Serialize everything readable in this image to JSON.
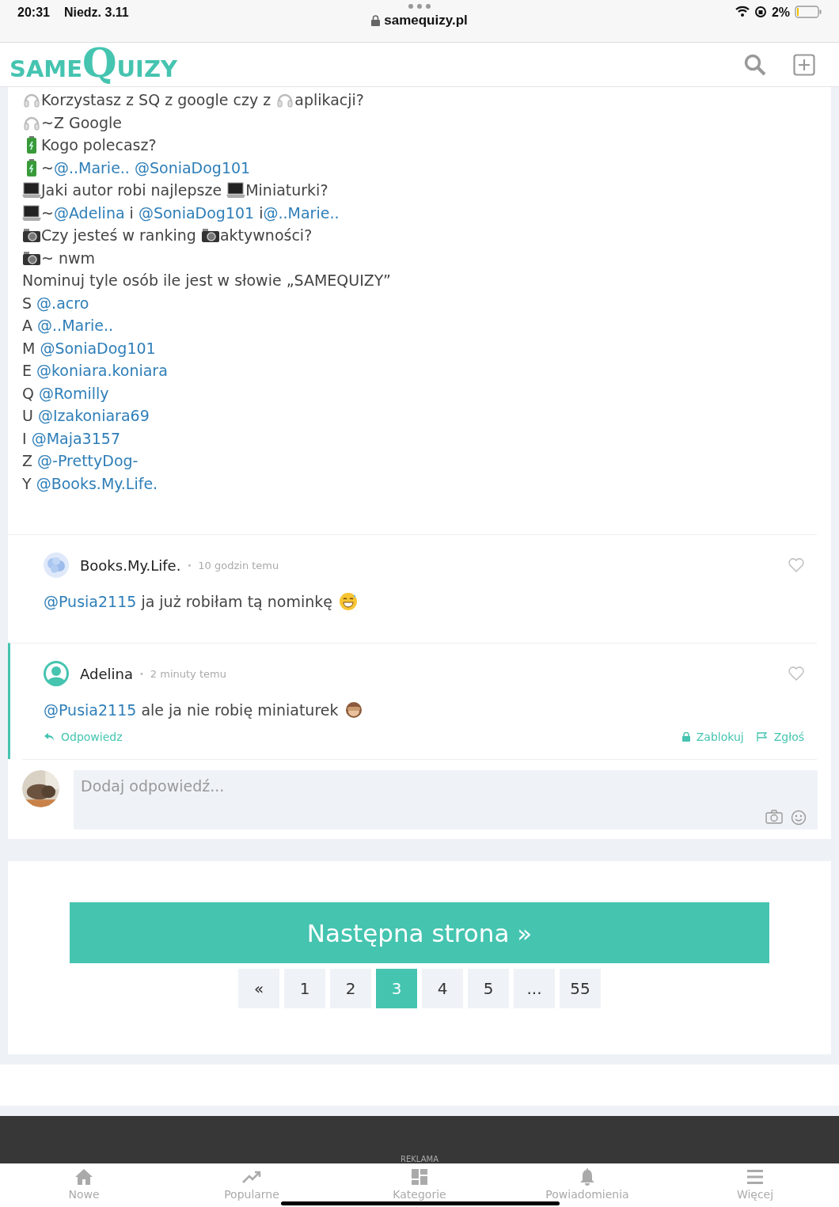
{
  "status_bar": {
    "time": "20:31",
    "date": "Niedz. 3.11",
    "battery": "2%",
    "url": "samequizy.pl"
  },
  "header": {
    "logo_small": "SAME",
    "logo_big": "Q",
    "logo_rest": "UIZY"
  },
  "post": {
    "lines": [
      [
        {
          "kind": "headphones"
        },
        {
          "kind": "text",
          "text": "Korzystasz z SQ z google czy z "
        },
        {
          "kind": "headphones"
        },
        {
          "kind": "text",
          "text": "aplikacji?"
        }
      ],
      [
        {
          "kind": "headphones"
        },
        {
          "kind": "text",
          "text": "~Z Google"
        }
      ],
      [
        {
          "kind": "battery"
        },
        {
          "kind": "text",
          "text": "Kogo polecasz?"
        }
      ],
      [
        {
          "kind": "battery"
        },
        {
          "kind": "text",
          "text": "~"
        },
        {
          "kind": "mention",
          "text": "@..Marie.."
        },
        {
          "kind": "mention",
          "text": " @SoniaDog101"
        }
      ],
      [
        {
          "kind": "laptop"
        },
        {
          "kind": "text",
          "text": "Jaki autor robi najlepsze "
        },
        {
          "kind": "laptop"
        },
        {
          "kind": "text",
          "text": "Miniaturki?"
        }
      ],
      [
        {
          "kind": "laptop"
        },
        {
          "kind": "text",
          "text": "~"
        },
        {
          "kind": "mention",
          "text": "@Adelina"
        },
        {
          "kind": "text",
          "text": " i "
        },
        {
          "kind": "mention",
          "text": "@SoniaDog101"
        },
        {
          "kind": "text",
          "text": " i"
        },
        {
          "kind": "mention",
          "text": "@..Marie.."
        }
      ],
      [
        {
          "kind": "camera"
        },
        {
          "kind": "text",
          "text": "Czy jesteś w ranking "
        },
        {
          "kind": "camera"
        },
        {
          "kind": "text",
          "text": "aktywności?"
        }
      ],
      [
        {
          "kind": "camera"
        },
        {
          "kind": "text",
          "text": "~ nwm"
        }
      ],
      [
        {
          "kind": "text",
          "text": "Nominuj tyle osób ile jest w słowie „SAMEQUIZY”"
        }
      ],
      [
        {
          "kind": "text",
          "text": "S "
        },
        {
          "kind": "mention",
          "text": "@.acro"
        }
      ],
      [
        {
          "kind": "text",
          "text": "A "
        },
        {
          "kind": "mention",
          "text": "@..Marie.."
        }
      ],
      [
        {
          "kind": "text",
          "text": "M "
        },
        {
          "kind": "mention",
          "text": "@SoniaDog101"
        }
      ],
      [
        {
          "kind": "text",
          "text": "E "
        },
        {
          "kind": "mention",
          "text": "@koniara.koniara"
        }
      ],
      [
        {
          "kind": "text",
          "text": "Q "
        },
        {
          "kind": "mention",
          "text": "@Romilly"
        }
      ],
      [
        {
          "kind": "text",
          "text": "U "
        },
        {
          "kind": "mention",
          "text": "@Izakoniara69"
        }
      ],
      [
        {
          "kind": "text",
          "text": "I "
        },
        {
          "kind": "mention",
          "text": "@Maja3157"
        }
      ],
      [
        {
          "kind": "text",
          "text": "Z "
        },
        {
          "kind": "mention",
          "text": "@-PrettyDog-"
        }
      ],
      [
        {
          "kind": "text",
          "text": "Y "
        },
        {
          "kind": "mention",
          "text": "@Books.My.Life."
        }
      ]
    ]
  },
  "comments": [
    {
      "author": "Books.My.Life.",
      "separator": "•",
      "time": "10 godzin temu",
      "mention": "@Pusia2115",
      "text": " ja już robiłam tą nominkę",
      "selected": false
    },
    {
      "kind": "default",
      "author": "Adelina",
      "separator": "•",
      "time": "2 minuty temu",
      "mention": "@Pusia2115",
      "text": " ale ja nie robię miniaturek",
      "selected": true,
      "actions": {
        "reply": "Odpowiedz",
        "block": "Zablokuj",
        "report": "Zgłoś"
      }
    }
  ],
  "reply_field": {
    "placeholder": "Dodaj odpowiedź..."
  },
  "next_button": "Następna strona »",
  "pagination": [
    {
      "label": "«",
      "selected": false
    },
    {
      "label": "1",
      "selected": false
    },
    {
      "label": "2",
      "selected": false
    },
    {
      "label": "3",
      "selected": true
    },
    {
      "label": "4",
      "selected": false
    },
    {
      "label": "5",
      "selected": false
    },
    {
      "label": "...",
      "selected": false
    },
    {
      "label": "55",
      "selected": false
    }
  ],
  "ad_label": "REKLAMA",
  "bottom_nav": [
    {
      "kind": "home",
      "label": "Nowe"
    },
    {
      "kind": "trend",
      "label": "Popularne"
    },
    {
      "kind": "grid",
      "label": "Kategorie"
    },
    {
      "kind": "bell",
      "label": "Powiadomienia"
    },
    {
      "kind": "menu",
      "label": "Więcej"
    }
  ]
}
